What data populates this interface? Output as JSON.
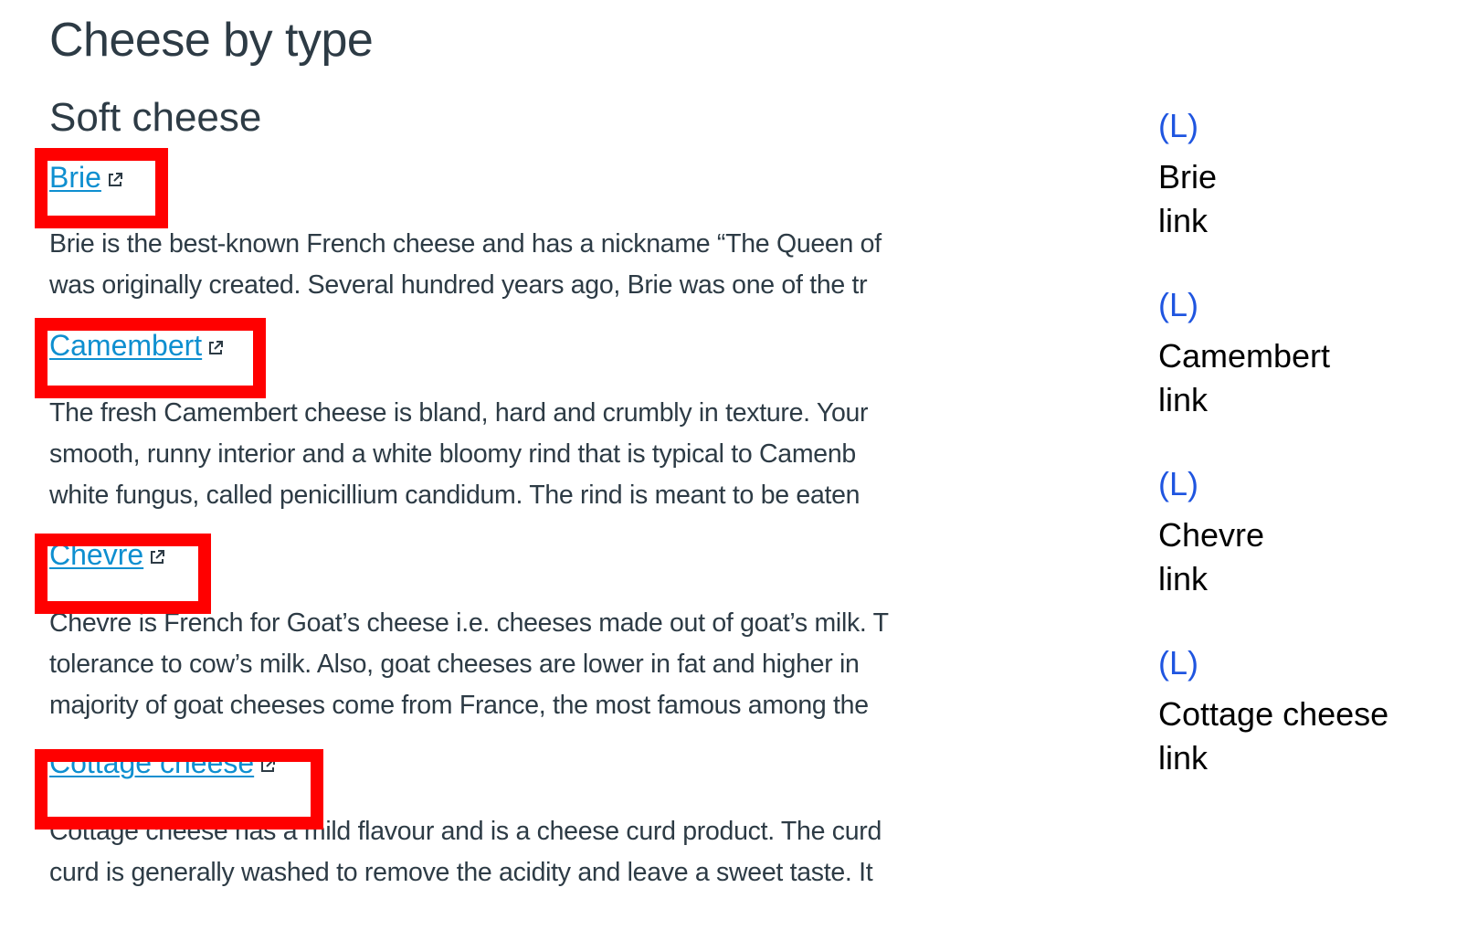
{
  "page": {
    "title": "Cheese by type",
    "section_title": "Soft cheese"
  },
  "cheeses": [
    {
      "link_text": "Brie",
      "external_icon": "external-link-icon",
      "description_lines": [
        "Brie is the best-known French cheese and has a nickname “The Queen of",
        "was originally created. Several hundred years ago, Brie was one of the tr"
      ]
    },
    {
      "link_text": "Camembert",
      "external_icon": "external-link-icon",
      "description_lines": [
        "The fresh Camembert cheese is bland, hard and crumbly in texture. Your",
        "smooth, runny interior and a white bloomy rind that is typical to Camenb",
        "white fungus, called penicillium candidum. The rind is meant to be eaten"
      ]
    },
    {
      "link_text": "Chevre",
      "external_icon": "external-link-icon",
      "description_lines": [
        "Chevre is French for Goat’s cheese i.e. cheeses made out of goat’s milk. T",
        "tolerance to cow’s milk. Also, goat cheeses are lower in fat and higher in",
        "majority of goat cheeses come from France, the most famous among the"
      ]
    },
    {
      "link_text": "Cottage cheese",
      "external_icon": "external-link-icon",
      "description_lines": [
        "Cottage cheese has a mild flavour and is a cheese curd product. The curd",
        "curd is generally washed to remove the acidity and leave a sweet taste. It"
      ]
    }
  ],
  "annotations": [
    {
      "tag": "(L)",
      "label_line1": "Brie",
      "label_line2": "link"
    },
    {
      "tag": "(L)",
      "label_line1": "Camembert",
      "label_line2": "link"
    },
    {
      "tag": "(L)",
      "label_line1": "Chevre",
      "label_line2": "link"
    },
    {
      "tag": "(L)",
      "label_line1": "Cottage cheese",
      "label_line2": "link"
    }
  ],
  "colors": {
    "link": "#0e8fd0",
    "text": "#2d3b45",
    "highlight": "#ff0000",
    "annotation_tag": "#1f55e0"
  }
}
